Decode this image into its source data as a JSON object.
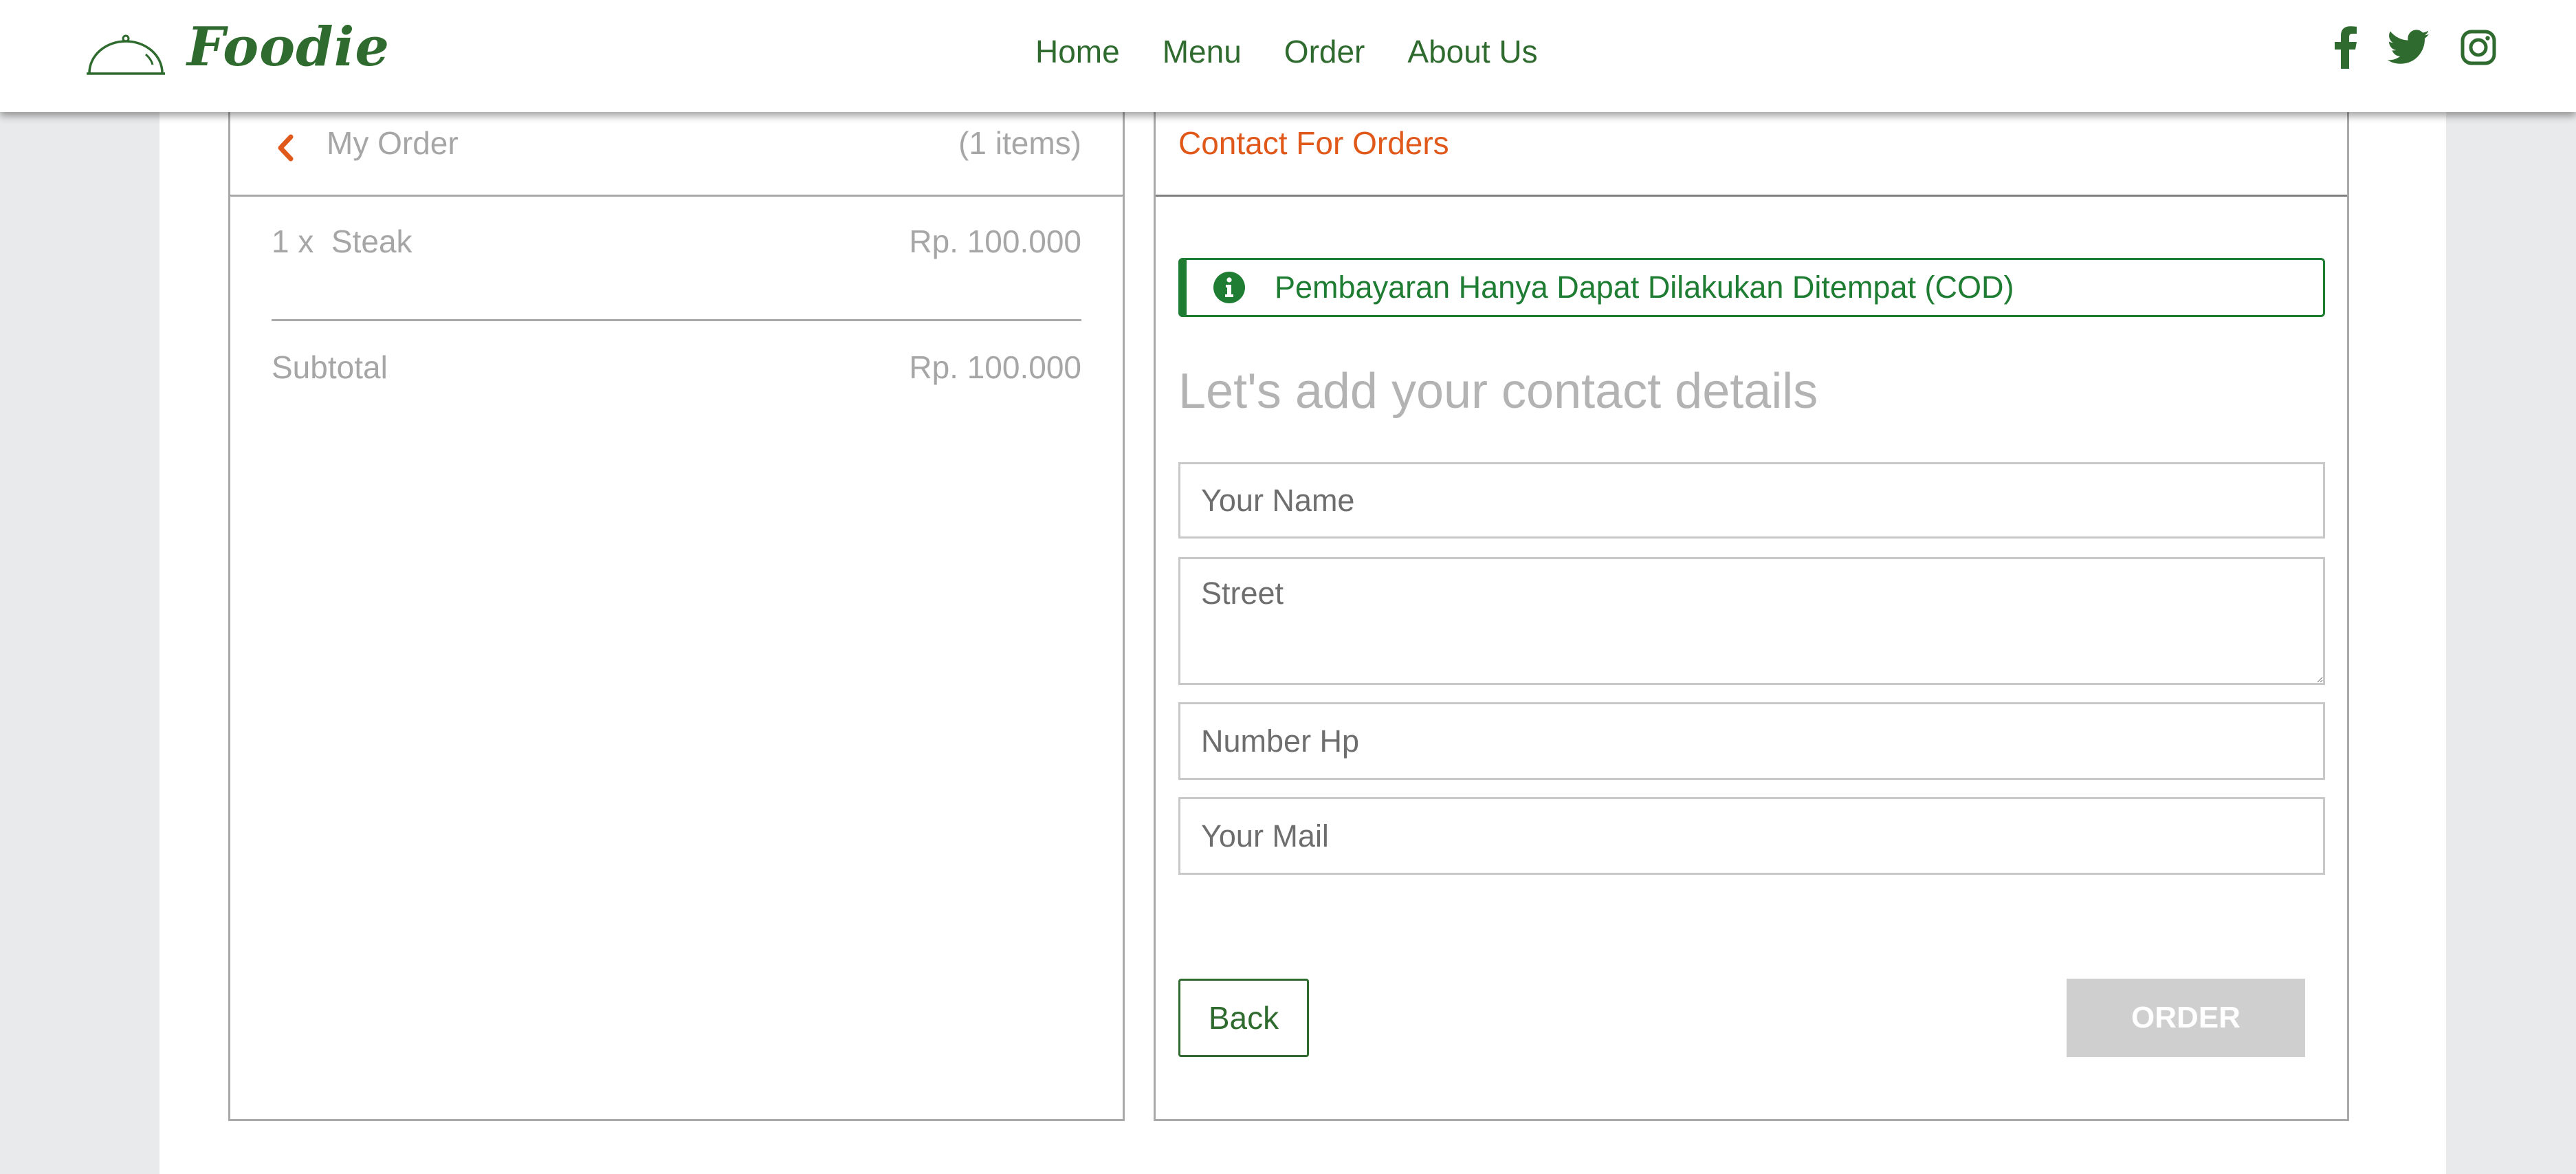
{
  "brand": {
    "name": "Foodie"
  },
  "nav": {
    "links": [
      "Home",
      "Menu",
      "Order",
      "About Us"
    ]
  },
  "social": {
    "icons": [
      "facebook-icon",
      "twitter-icon",
      "instagram-icon"
    ]
  },
  "order": {
    "title": "My Order",
    "count": "(1 items)",
    "items": [
      {
        "label": "1 x  Steak",
        "price": "Rp. 100.000"
      }
    ],
    "subtotal_label": "Subtotal",
    "subtotal_value": "Rp. 100.000"
  },
  "contact": {
    "title": "Contact For Orders",
    "alert": "Pembayaran Hanya Dapat Dilakukan Ditempat (COD)",
    "heading": "Let's add your contact details",
    "fields": {
      "name_placeholder": "Your Name",
      "street_placeholder": "Street",
      "phone_placeholder": "Number Hp",
      "mail_placeholder": "Your Mail"
    },
    "back_label": "Back",
    "order_label": "ORDER"
  },
  "colors": {
    "brand_green": "#2f6b2f",
    "alert_green": "#1e7d32",
    "accent_orange": "#e0591a",
    "disabled_button": "#cfcfcf",
    "muted_text": "#a6a6a6"
  }
}
